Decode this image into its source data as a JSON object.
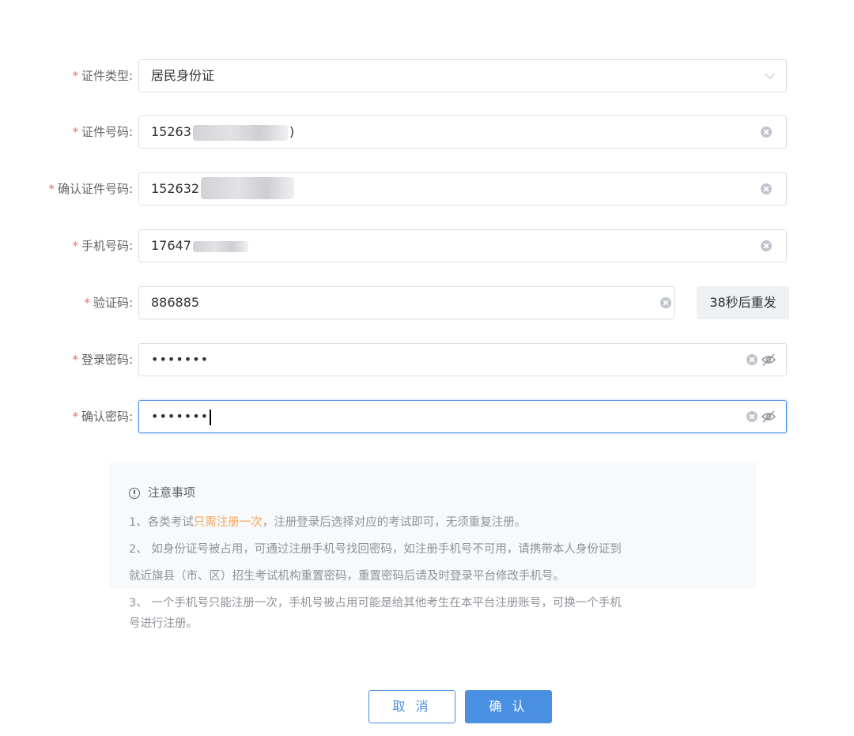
{
  "form": {
    "fields": [
      {
        "label": "证件类型:",
        "value": "居民身份证"
      },
      {
        "label": "证件号码:",
        "value": "15263",
        "value_tail": ")"
      },
      {
        "label": "确认证件号码:",
        "value": "152632"
      },
      {
        "label": "手机号码:",
        "value": "17647"
      },
      {
        "label": "验证码:",
        "value": "886885"
      },
      {
        "label": "登录密码:",
        "value": "•••••••"
      },
      {
        "label": "确认密码:",
        "value": "•••••••"
      }
    ],
    "required_mark": "*",
    "sms_button": "38秒后重发"
  },
  "notice": {
    "title": "注意事项",
    "line1_pre": "1、各类考试",
    "line1_hl": "只需注册一次",
    "line1_post": "，注册登录后选择对应的考试即可，无须重复注册。",
    "line2": "2、 如身份证号被占用，可通过注册手机号找回密码，如注册手机号不可用，请携带本人身份证到",
    "line3": "就近旗县（市、区）招生考试机构重置密码，重置密码后请及时登录平台修改手机号。",
    "line4": "3、 一个手机号只能注册一次，手机号被占用可能是给其他考生在本平台注册账号，可换一个手机",
    "line5": "号进行注册。"
  },
  "buttons": {
    "cancel": "取 消",
    "confirm": "确 认"
  },
  "colors": {
    "accent": "#4a90e2",
    "required": "#f56c6c",
    "highlight": "#f0a85e"
  }
}
